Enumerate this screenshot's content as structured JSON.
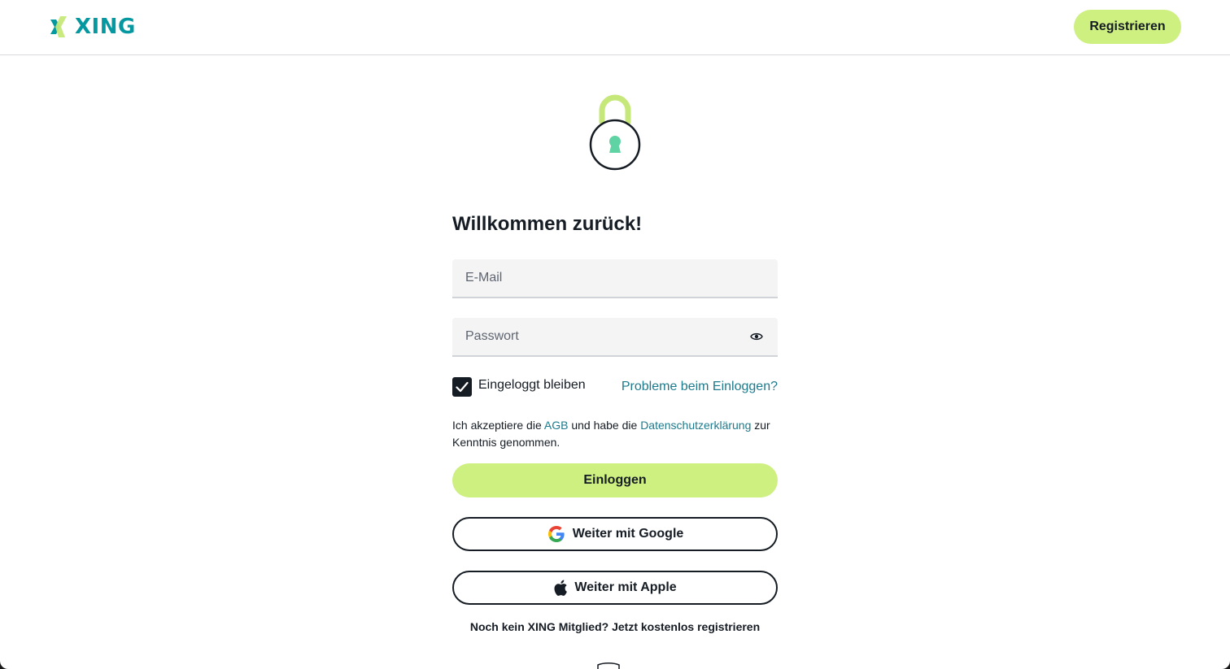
{
  "header": {
    "logo_text": "XING",
    "logo_icon": "xing-x-icon",
    "register_label": "Registrieren"
  },
  "login": {
    "lock_icon": "padlock-icon",
    "heading": "Willkommen zurück!",
    "email_placeholder": "E-Mail",
    "password_placeholder": "Passwort",
    "show_password_icon": "eye-icon",
    "stay_logged_in_label": "Eingeloggt bleiben",
    "stay_logged_in_checked": true,
    "trouble_link": "Probleme beim Einloggen?",
    "terms": {
      "prefix": "Ich akzeptiere die ",
      "agb_link": "AGB",
      "middle": " und habe die ",
      "privacy_link": "Datenschutzerklärung",
      "suffix": " zur Kenntnis genommen."
    },
    "login_button": "Einloggen",
    "google_button": "Weiter mit Google",
    "apple_button": "Weiter mit Apple",
    "signup_link": "Noch kein XING Mitglied? Jetzt kostenlos registrieren"
  },
  "colors": {
    "brand_teal": "#0698a0",
    "accent_lime": "#cdf080",
    "link": "#1d7a8c",
    "text": "#161c24",
    "lock_shackle": "#c6e87a",
    "keyhole": "#5fd3a3"
  }
}
